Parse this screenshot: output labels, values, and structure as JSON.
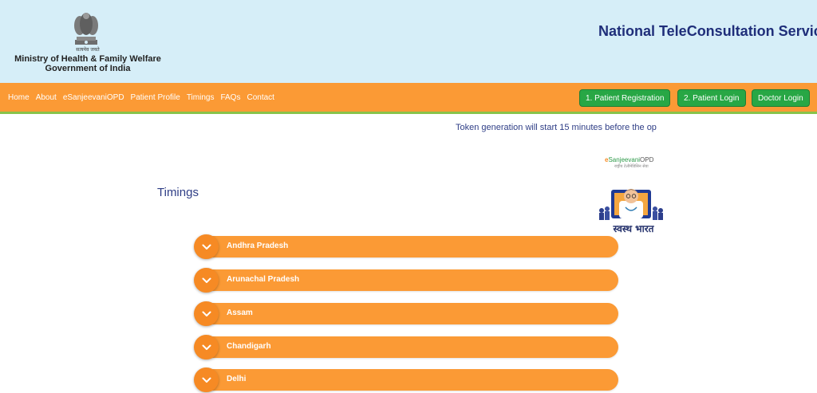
{
  "header": {
    "emblem_motto": "सत्यमेव जयते",
    "ministry_line1": "Ministry of Health & Family Welfare",
    "ministry_line2": "Government of India",
    "service_title": "National TeleConsultation Service"
  },
  "nav": {
    "links": [
      "Home",
      "About",
      "eSanjeevaniOPD",
      "Patient Profile",
      "Timings",
      "FAQs",
      "Contact"
    ],
    "buttons": {
      "registration": "1. Patient Registration",
      "login": "2. Patient Login",
      "doctor": "Doctor Login"
    }
  },
  "notice": {
    "marquee": "Token generation will start 15 minutes before the op"
  },
  "brand": {
    "prefix": "e",
    "name_green": "Sanjeevani",
    "name_suffix": "OPD",
    "tagline": "राष्ट्रीय टेलीमेडिसिन सेवा",
    "swasth": "स्वस्थ भारत"
  },
  "timings": {
    "title": "Timings",
    "states": [
      "Andhra Pradesh",
      "Arunachal Pradesh",
      "Assam",
      "Chandigarh",
      "Delhi"
    ]
  },
  "colors": {
    "header_bg": "#d6eef8",
    "nav_bg": "#fb9a35",
    "nav_border": "#88c34a",
    "button_green": "#28a745",
    "title_blue": "#1f2e7a",
    "accordion": "#fb9a35"
  },
  "icons": {
    "emblem": "national-emblem-icon",
    "accordion_toggle": "chevron-down-icon",
    "doctor": "doctor-illustration-icon"
  }
}
